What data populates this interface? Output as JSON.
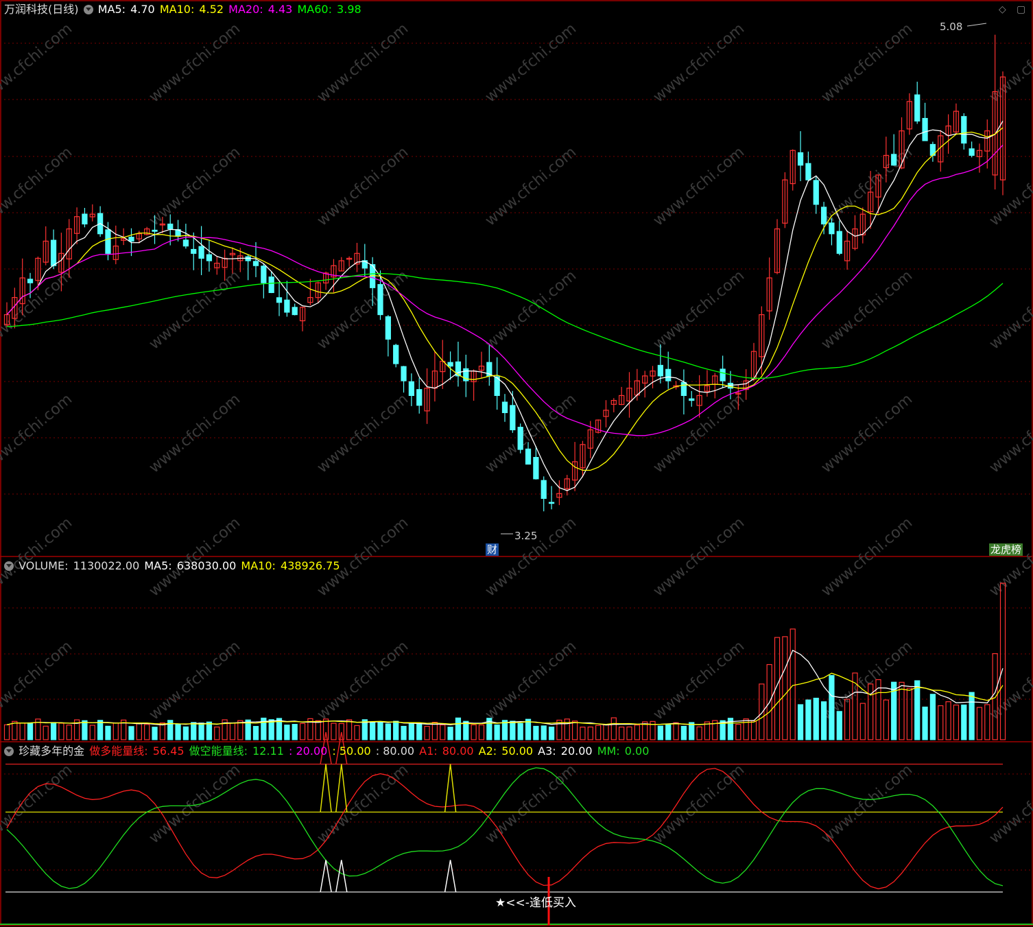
{
  "header": {
    "stock_name": "万润科技(日线)",
    "ma5_label": "MA5:",
    "ma5_value": "4.70",
    "ma10_label": "MA10:",
    "ma10_value": "4.52",
    "ma20_label": "MA20:",
    "ma20_value": "4.43",
    "ma60_label": "MA60:",
    "ma60_value": "3.98"
  },
  "volume_header": {
    "label": "VOLUME:",
    "value": "1130022.00",
    "ma5_label": "MA5:",
    "ma5_value": "638030.00",
    "ma10_label": "MA10:",
    "ma10_value": "438926.75"
  },
  "indicator_header": {
    "name": "珍藏多年的金",
    "bull_label": "做多能量线:",
    "bull_value": "56.45",
    "bear_label": "做空能量线:",
    "bear_value": "12.11",
    "l20": ": 20.00",
    "l50": ": 50.00",
    "l80": ": 80.00",
    "a1_label": "A1:",
    "a1_value": "80.00",
    "a2_label": "A2:",
    "a2_value": "50.00",
    "a3_label": "A3:",
    "a3_value": "20.00",
    "mm_label": "MM:",
    "mm_value": "0.00"
  },
  "annotations": {
    "high_price": "5.08",
    "low_price": "3.25",
    "fin_tag": "财",
    "rank_tag": "龙虎榜",
    "buy_signal": "★<<-逢低买入",
    "watermark": "www.cfchi.com"
  },
  "colors": {
    "up": "#ff3232",
    "down": "#54ffff",
    "ma5": "#ffffff",
    "ma10": "#ffff00",
    "ma20": "#ff00ff",
    "ma60": "#00ff00",
    "bull": "#ff2020",
    "bear": "#20e020",
    "frame": "#a00000"
  },
  "chart_data": {
    "type": "candlestick",
    "title": "万润科技(日线)",
    "price_range": [
      3.25,
      5.08
    ],
    "ohlc_closes": [
      4.05,
      4.12,
      4.2,
      4.18,
      4.28,
      4.35,
      4.25,
      4.3,
      4.4,
      4.45,
      4.42,
      4.46,
      4.38,
      4.3,
      4.33,
      4.36,
      4.35,
      4.38,
      4.4,
      4.39,
      4.42,
      4.4,
      4.37,
      4.33,
      4.3,
      4.28,
      4.27,
      4.26,
      4.28,
      4.3,
      4.29,
      4.27,
      4.25,
      4.18,
      4.14,
      4.1,
      4.06,
      4.05,
      4.08,
      4.12,
      4.18,
      4.22,
      4.25,
      4.27,
      4.28,
      4.3,
      4.24,
      4.16,
      4.05,
      3.95,
      3.85,
      3.78,
      3.72,
      3.68,
      3.75,
      3.82,
      3.86,
      3.84,
      3.8,
      3.78,
      3.82,
      3.84,
      3.8,
      3.72,
      3.65,
      3.58,
      3.5,
      3.44,
      3.38,
      3.3,
      3.28,
      3.32,
      3.38,
      3.45,
      3.52,
      3.58,
      3.62,
      3.66,
      3.7,
      3.72,
      3.75,
      3.78,
      3.8,
      3.82,
      3.8,
      3.78,
      3.76,
      3.72,
      3.7,
      3.72,
      3.76,
      3.8,
      3.78,
      3.75,
      3.73,
      3.78,
      3.9,
      4.05,
      4.2,
      4.4,
      4.6,
      4.72,
      4.66,
      4.6,
      4.5,
      4.42,
      4.38,
      4.3,
      4.35,
      4.4,
      4.46,
      4.55,
      4.62,
      4.7,
      4.66,
      4.8,
      4.92,
      4.84,
      4.76,
      4.7,
      4.78,
      4.82,
      4.88,
      4.75,
      4.7,
      4.72,
      4.8,
      4.96,
      5.02
    ],
    "volume_peak": 1130022.0,
    "volume": {
      "last": 1130022.0,
      "ma5": 638030.0,
      "ma10": 438926.75
    },
    "moving_averages": {
      "MA5": 4.7,
      "MA10": 4.52,
      "MA20": 4.43,
      "MA60": 3.98
    },
    "indicator": {
      "name": "珍藏多年的金",
      "series": [
        {
          "name": "做多能量线",
          "last": 56.45
        },
        {
          "name": "做空能量线",
          "last": 12.11
        }
      ],
      "levels": {
        "A1": 80.0,
        "A2": 50.0,
        "A3": 20.0,
        "MM": 0.0
      }
    }
  }
}
